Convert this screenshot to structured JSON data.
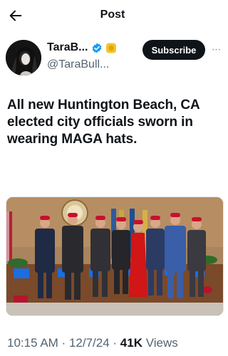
{
  "header": {
    "title": "Post"
  },
  "author": {
    "display_name": "TaraB...",
    "handle": "@TaraBull...",
    "subscribe_label": "Subscribe",
    "more_label": "···",
    "verified_color": "#1d9bf0",
    "gold_badge_color": "#f4c430"
  },
  "post": {
    "text": "All new Huntington Beach, CA elected city officials sworn in wearing MAGA hats."
  },
  "meta": {
    "time": "10:15 AM",
    "date": "12/7/24",
    "separator": " · ",
    "views_count": "41K",
    "views_label": " Views"
  },
  "icons": [
    "back-arrow-icon",
    "verified-badge-icon",
    "gold-badge-icon",
    "more-icon"
  ]
}
